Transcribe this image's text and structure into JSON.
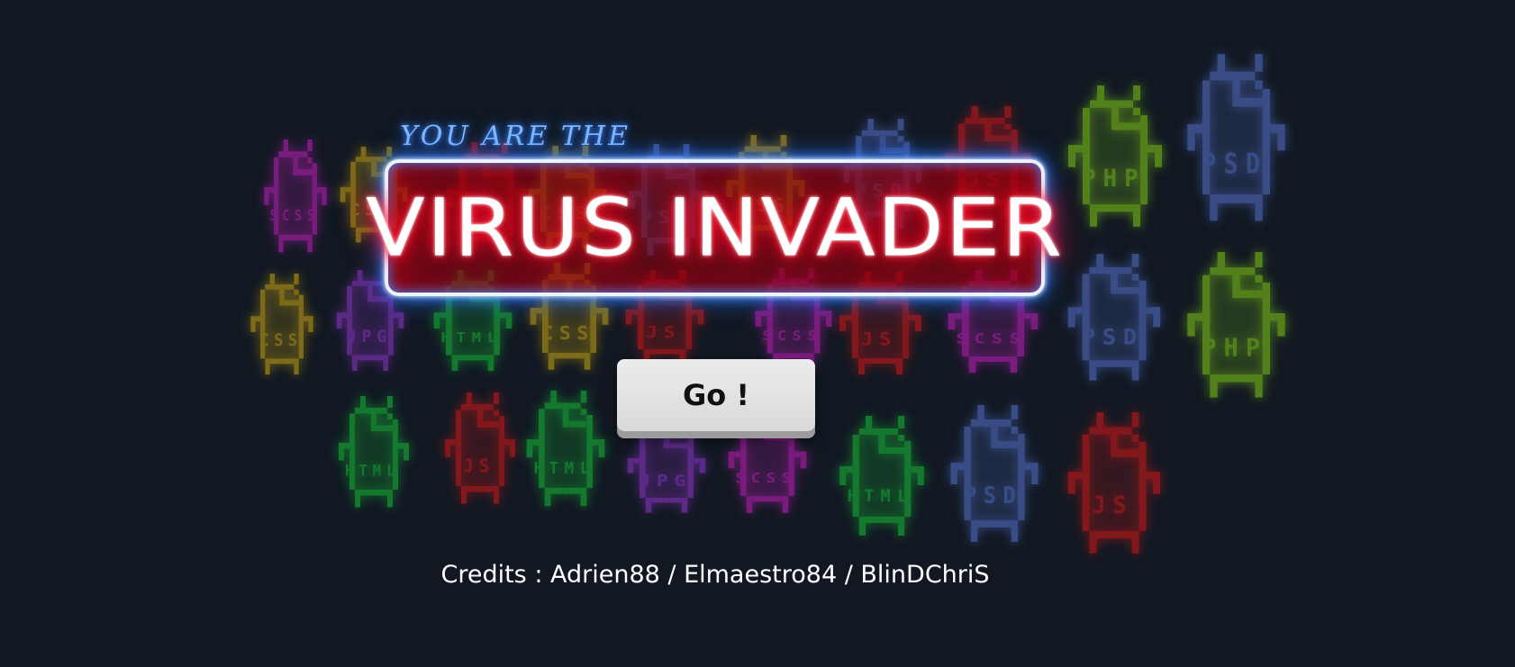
{
  "game": {
    "subtitle": "YOU ARE THE",
    "title": "VIRUS INVADER",
    "go_button": "Go !",
    "credits": "Credits : Adrien88 / Elmaestro84 / BlinDChriS"
  },
  "colors": {
    "background": "#111822",
    "title_glow": "#ff0022",
    "frame_glow": "#3a8cff",
    "button": "#e3e3e3"
  },
  "invaders": [
    {
      "label": "SCSS",
      "color": "#d020c8",
      "icon": "file-bug-icon"
    },
    {
      "label": "CSS",
      "color": "#d8b012",
      "icon": "file-bug-icon"
    },
    {
      "label": "JS",
      "color": "#e01818",
      "icon": "file-bug-icon"
    },
    {
      "label": "CSS",
      "color": "#d8b012",
      "icon": "file-bug-icon"
    },
    {
      "label": "PSD",
      "color": "#5a78d8",
      "icon": "file-bug-icon"
    },
    {
      "label": "CSS",
      "color": "#d8b012",
      "icon": "file-bug-icon"
    },
    {
      "label": "PSD",
      "color": "#5a78d8",
      "icon": "file-bug-icon"
    },
    {
      "label": "JS",
      "color": "#e01818",
      "icon": "file-bug-icon"
    },
    {
      "label": "PHP",
      "color": "#88d818",
      "icon": "file-bug-icon"
    },
    {
      "label": "PSD",
      "color": "#5a78d8",
      "icon": "file-bug-icon"
    },
    {
      "label": "CSS",
      "color": "#d8b012",
      "icon": "file-bug-icon"
    },
    {
      "label": "JPG",
      "color": "#9a3ad8",
      "icon": "file-bug-icon"
    },
    {
      "label": "HTML",
      "color": "#18c838",
      "icon": "file-bug-icon"
    },
    {
      "label": "CSS",
      "color": "#d8b012",
      "icon": "file-bug-icon"
    },
    {
      "label": "JS",
      "color": "#e01818",
      "icon": "file-bug-icon"
    },
    {
      "label": "SCSS",
      "color": "#d020c8",
      "icon": "file-bug-icon"
    },
    {
      "label": "JS",
      "color": "#e01818",
      "icon": "file-bug-icon"
    },
    {
      "label": "SCSS",
      "color": "#d020c8",
      "icon": "file-bug-icon"
    },
    {
      "label": "PSD",
      "color": "#5a78d8",
      "icon": "file-bug-icon"
    },
    {
      "label": "PHP",
      "color": "#88d818",
      "icon": "file-bug-icon"
    },
    {
      "label": "HTML",
      "color": "#18c838",
      "icon": "file-bug-icon"
    },
    {
      "label": "JS",
      "color": "#e01818",
      "icon": "file-bug-icon"
    },
    {
      "label": "HTML",
      "color": "#18c838",
      "icon": "file-bug-icon"
    },
    {
      "label": "JPG",
      "color": "#9a3ad8",
      "icon": "file-bug-icon"
    },
    {
      "label": "SCSS",
      "color": "#d020c8",
      "icon": "file-bug-icon"
    },
    {
      "label": "HTML",
      "color": "#18c838",
      "icon": "file-bug-icon"
    },
    {
      "label": "PSD",
      "color": "#5a78d8",
      "icon": "file-bug-icon"
    },
    {
      "label": "JS",
      "color": "#e01818",
      "icon": "file-bug-icon"
    }
  ]
}
